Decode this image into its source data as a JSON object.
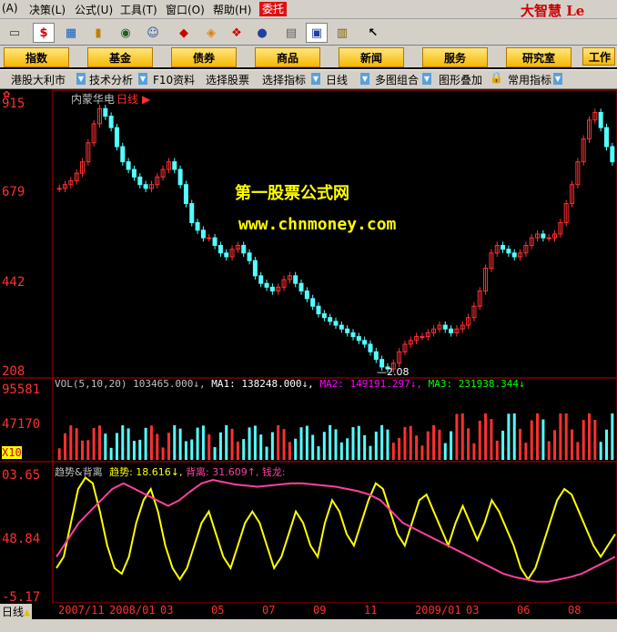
{
  "menu": {
    "items": [
      "(A)",
      "决策(L)",
      "公式(U)",
      "工具(T)",
      "窗口(O)",
      "帮助(H)"
    ],
    "weituo": "委托",
    "brand": "大智慧 Le"
  },
  "buttons": [
    "指数",
    "基金",
    "债券",
    "商品",
    "新闻",
    "服务",
    "研究室",
    "工作"
  ],
  "tabs": [
    "港股大利市",
    "技术分析",
    "F10资料",
    "选择股票",
    "选择指标",
    "日线",
    "多图组合",
    "图形叠加",
    "常用指标"
  ],
  "stock": {
    "name": "内蒙华电",
    "period": "日线"
  },
  "price_axis": [
    "915",
    "679",
    "442",
    "208"
  ],
  "low_marker": "2.08",
  "watermark": {
    "line1": "第一股票公式网",
    "line2": "www.chnmoney.com"
  },
  "volume": {
    "axis": [
      "95581",
      "47170",
      "X10"
    ],
    "name": "VOL(5,10,20)",
    "value": "103465.000",
    "ma1": "MA1: 138248.000",
    "ma2": "MA2: 149191.297",
    "ma3": "MA3: 231938.344"
  },
  "indicator": {
    "axis": [
      "03.65",
      "48.84",
      "-5.17"
    ],
    "name": "趋势&背离",
    "trend": "趋势: 18.616",
    "divergence": "背离: 31.609",
    "qianlong": "钱龙:"
  },
  "date_axis": [
    "2007/11",
    "2008/01",
    "03",
    "05",
    "07",
    "09",
    "11",
    "2009/01",
    "03",
    "06",
    "08"
  ],
  "period_label": "日线",
  "colors": {
    "up": "#ff3030",
    "down": "#54ffff",
    "trend": "#ffff00",
    "divergence": "#ff40a0",
    "ma1": "#ffffff",
    "ma2": "#ff00ff",
    "ma3": "#00ff00"
  },
  "chart_data": {
    "type": "line",
    "title": "内蒙华电 日线",
    "price_ylim": [
      208,
      915
    ],
    "price_close": [
      690,
      700,
      710,
      730,
      760,
      810,
      860,
      900,
      880,
      850,
      800,
      760,
      740,
      720,
      700,
      690,
      700,
      720,
      740,
      760,
      740,
      700,
      650,
      600,
      580,
      560,
      560,
      540,
      520,
      510,
      530,
      540,
      520,
      500,
      460,
      440,
      430,
      420,
      430,
      450,
      460,
      440,
      420,
      400,
      380,
      360,
      350,
      340,
      330,
      320,
      310,
      300,
      290,
      280,
      260,
      240,
      220,
      215,
      230,
      260,
      280,
      290,
      300,
      300,
      310,
      320,
      330,
      320,
      310,
      320,
      330,
      350,
      380,
      420,
      480,
      520,
      540,
      530,
      520,
      510,
      520,
      540,
      560,
      570,
      560,
      560,
      570,
      600,
      650,
      700,
      760,
      820,
      870,
      890,
      850,
      800,
      760
    ],
    "volume_ylim": [
      0,
      95581
    ],
    "trend_ylim": [
      -5.17,
      103.65
    ],
    "trend_values": [
      20,
      30,
      60,
      90,
      100,
      95,
      70,
      40,
      20,
      15,
      30,
      60,
      80,
      90,
      70,
      40,
      20,
      10,
      20,
      40,
      60,
      70,
      50,
      30,
      20,
      40,
      60,
      70,
      60,
      40,
      20,
      30,
      50,
      70,
      60,
      40,
      30,
      60,
      80,
      70,
      50,
      40,
      60,
      80,
      95,
      90,
      70,
      50,
      40,
      60,
      80,
      85,
      70,
      55,
      40,
      60,
      75,
      60,
      45,
      60,
      80,
      70,
      55,
      40,
      20,
      10,
      20,
      40,
      60,
      80,
      90,
      85,
      70,
      55,
      40,
      30,
      40,
      50
    ],
    "divergence_values": [
      30,
      45,
      60,
      70,
      80,
      90,
      95,
      90,
      85,
      80,
      75,
      80,
      88,
      95,
      98,
      96,
      94,
      93,
      92,
      93,
      94,
      95,
      95,
      94,
      93,
      92,
      90,
      88,
      85,
      80,
      70,
      60,
      55,
      50,
      45,
      40,
      35,
      30,
      25,
      20,
      15,
      12,
      10,
      8,
      8,
      10,
      12,
      15,
      20,
      25,
      30
    ],
    "dates": [
      "2007/11",
      "2008/01",
      "03",
      "05",
      "07",
      "09",
      "11",
      "2009/01",
      "03",
      "06",
      "08"
    ]
  }
}
